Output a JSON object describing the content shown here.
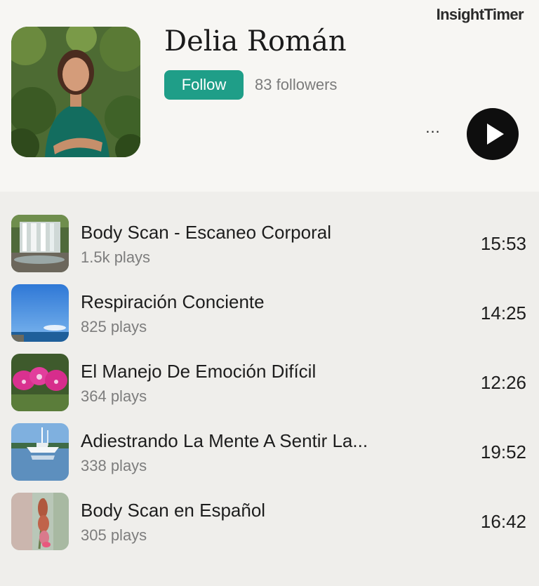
{
  "brand": {
    "name": "InsightTimer"
  },
  "teacher": {
    "name": "Delia Román",
    "follow_label": "Follow",
    "followers": "83 followers",
    "more_label": "...",
    "colors": {
      "follow": "#1f9e88",
      "play": "#0e0e0e"
    }
  },
  "tracks": [
    {
      "title": "Body Scan - Escaneo Corporal",
      "plays": "1.5k plays",
      "duration": "15:53",
      "thumb": "waterfall"
    },
    {
      "title": "Respiración Conciente",
      "plays": "825 plays",
      "duration": "14:25",
      "thumb": "blue-sky-ocean"
    },
    {
      "title": "El Manejo De Emoción Difícil",
      "plays": "364 plays",
      "duration": "12:26",
      "thumb": "pink-orchid"
    },
    {
      "title": "Adiestrando La Mente A Sentir La...",
      "plays": "338 plays",
      "duration": "19:52",
      "thumb": "sailboat"
    },
    {
      "title": "Body Scan en Español",
      "plays": "305 plays",
      "duration": "16:42",
      "thumb": "pink-flower"
    }
  ]
}
